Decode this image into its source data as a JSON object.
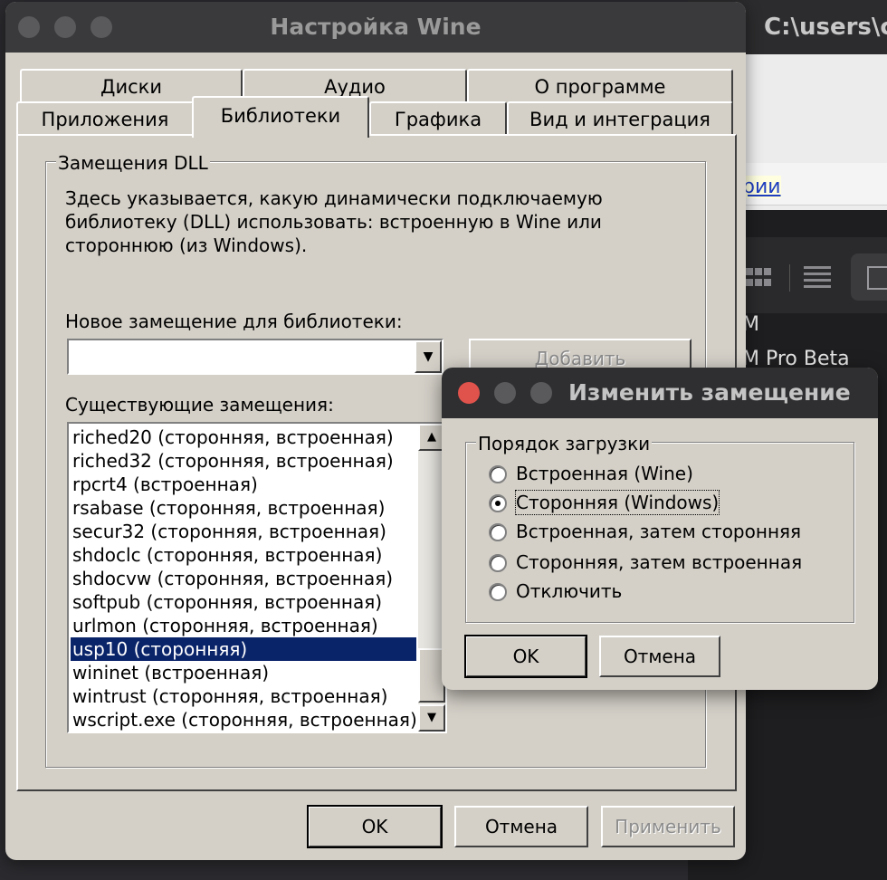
{
  "background_window": {
    "title": "C:\\users\\cr",
    "link_text": "рии",
    "text_line1": "M",
    "text_line2": "M Pro Beta"
  },
  "main_window": {
    "title": "Настройка Wine",
    "tabs_row1": [
      "Диски",
      "Аудио",
      "О программе"
    ],
    "tabs_row2": [
      "Приложения",
      "Библиотеки",
      "Графика",
      "Вид и интеграция"
    ],
    "active_tab": "Библиотеки",
    "group_title": "Замещения DLL",
    "description": [
      "Здесь указывается, какую динамически подключаемую",
      "библиотеку (DLL) использовать: встроенную в Wine или",
      "стороннюю (из Windows)."
    ],
    "new_override_label": "Новое замещение для библиотеки:",
    "new_override_value": "",
    "add_button": "Добавить",
    "existing_label": "Существующие замещения:",
    "overrides": [
      "riched20 (сторонняя, встроенная)",
      "riched32 (сторонняя, встроенная)",
      "rpcrt4 (встроенная)",
      "rsabase (сторонняя, встроенная)",
      "secur32 (сторонняя, встроенная)",
      "shdoclc (сторонняя, встроенная)",
      "shdocvw (сторонняя, встроенная)",
      "softpub (сторонняя, встроенная)",
      "urlmon (сторонняя, встроенная)",
      "usp10 (сторонняя)",
      "wininet (встроенная)",
      "wintrust (сторонняя, встроенная)",
      "wscript.exe (сторонняя, встроенная)"
    ],
    "selected_override_index": 9,
    "ok_button": "OK",
    "cancel_button": "Отмена",
    "apply_button": "Применить"
  },
  "dialog": {
    "title": "Изменить замещение",
    "group_title": "Порядок загрузки",
    "options": [
      "Встроенная (Wine)",
      "Сторонняя (Windows)",
      "Встроенная, затем сторонняя",
      "Сторонняя, затем встроенная",
      "Отключить"
    ],
    "selected_option_index": 1,
    "ok_button": "OK",
    "cancel_button": "Отмена"
  },
  "colors": {
    "window_face": "#d4d0c8",
    "selection": "#0a246a",
    "close_button": "#e0524c",
    "titlebar": "#3a3a3c"
  }
}
